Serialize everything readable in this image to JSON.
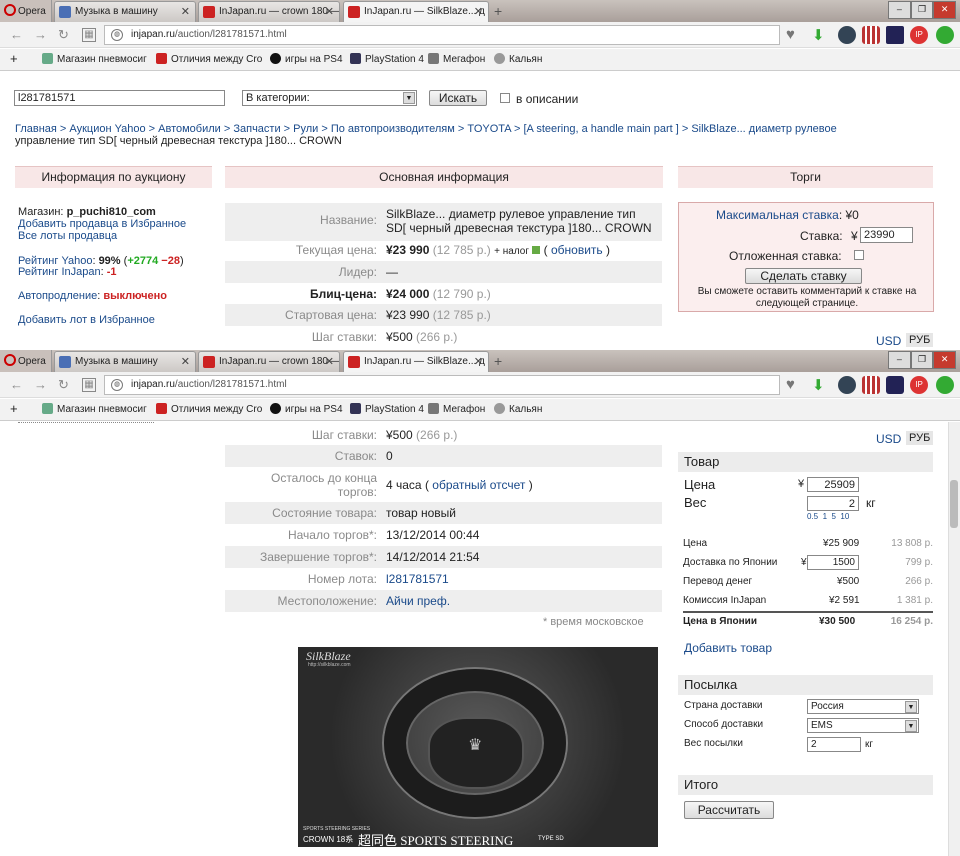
{
  "browser": {
    "opera_label": "Opera",
    "tabs": [
      {
        "label": "Музыка в машину"
      },
      {
        "label": "InJapan.ru — crown 180 —"
      },
      {
        "label": "InJapan.ru — SilkBlaze... д"
      }
    ],
    "url_host": "injapan.ru",
    "url_path": "/auction/l281781571.html",
    "bookmarks": [
      "Магазин пневмосиг",
      "Отличия между Cro",
      "игры на PS4",
      "PlayStation 4",
      "Мегафон",
      "Кальян"
    ]
  },
  "search": {
    "query": "l281781571",
    "category": "В категории:",
    "button": "Искать",
    "in_description": "в описании"
  },
  "breadcrumb": {
    "line1": "Главная > Аукцион Yahoo > Автомобили > Запчасти > Рули > По автопроизводителям > TOYOTA > [A steering, a handle main part ] > SilkBlaze... диаметр рулевое",
    "line2": "управление тип SD[ черный древесная текстура ]180... CROWN"
  },
  "auction_info": {
    "header": "Информация по аукциону",
    "shop_label": "Магазин:",
    "shop_name": "p_puchi810_com",
    "add_seller": "Добавить продавца в Избранное",
    "all_lots": "Все лоты продавца",
    "yahoo_rating_label": "Рейтинг Yahoo",
    "yahoo_rating": "99%",
    "rating_pos": "+2774",
    "rating_neg": "−28",
    "injapan_rating_label": "Рейтинг InJapan",
    "injapan_rating": "-1",
    "autoext_label": "Автопродление",
    "autoext_value": "выключено",
    "add_lot": "Добавить лот в Избранное"
  },
  "main_info": {
    "header": "Основная информация",
    "name_label": "Название:",
    "name_line1": "SilkBlaze... диаметр рулевое управление тип",
    "name_line2": "SD[ черный древесная текстура ]180... CROWN",
    "current_price_label": "Текущая цена:",
    "current_price": "¥23 990",
    "current_price_rub": "(12 785 р.)",
    "tax": "+ налог",
    "refresh": "обновить",
    "leader_label": "Лидер:",
    "leader": "—",
    "blitz_label": "Блиц-цена:",
    "blitz": "¥24 000",
    "blitz_rub": "(12 790 р.)",
    "start_label": "Стартовая цена:",
    "start": "¥23 990",
    "start_rub": "(12 785 р.)",
    "step_label": "Шаг ставки:",
    "step": "¥500",
    "step_rub": "(266 р.)",
    "bids_label": "Ставок:",
    "bids": "0",
    "remaining_label_1": "Осталось до конца",
    "remaining_label_2": "торгов:",
    "remaining": "4 часа",
    "countdown": "обратный отсчет",
    "condition_label": "Состояние товара:",
    "condition": "товар новый",
    "start_date_label": "Начало торгов*:",
    "start_date": "13/12/2014 00:44",
    "end_date_label": "Завершение торгов*:",
    "end_date": "14/12/2014 21:54",
    "lot_label": "Номер лота:",
    "lot": "l281781571",
    "location_label": "Местоположение:",
    "location": "Айчи преф.",
    "footnote": "* время московское"
  },
  "bidding": {
    "header": "Торги",
    "max_bid_label": "Максимальная ставка",
    "max_bid": "¥0",
    "bid_label": "Ставка:",
    "bid_value": "23990",
    "deferred_label": "Отложенная ставка:",
    "make_bid": "Сделать ставку",
    "note": "Вы сможете оставить комментарий к ставке на следующей странице."
  },
  "currency": {
    "usd": "USD",
    "rub": "РУБ"
  },
  "product": {
    "header": "Товар",
    "price_label": "Цена",
    "price_value": "25909",
    "weight_label": "Вес",
    "weight_value": "2",
    "weight_unit": "кг",
    "weight_presets": [
      "0.5",
      "1",
      "5",
      "10"
    ],
    "rows": [
      {
        "label": "Цена",
        "yen": "¥25 909",
        "rub": "13 808 р."
      },
      {
        "label": "Доставка по Японии",
        "yen": "1500",
        "rub": "799 р."
      },
      {
        "label": "Перевод денег",
        "yen": "¥500",
        "rub": "266 р."
      },
      {
        "label": "Комиссия InJapan",
        "yen": "¥2 591",
        "rub": "1 381 р."
      }
    ],
    "total_label": "Цена в Японии",
    "total_yen": "¥30 500",
    "total_rub": "16 254 р.",
    "add_product": "Добавить товар"
  },
  "parcel": {
    "header": "Посылка",
    "country_label": "Страна доставки",
    "country": "Россия",
    "method_label": "Способ доставки",
    "method": "EMS",
    "weight_label": "Вес посылки",
    "weight": "2",
    "unit": "кг"
  },
  "total": {
    "header": "Итого",
    "calc": "Рассчитать"
  },
  "image": {
    "brand": "SilkBlaze",
    "url": "http://silkblaze.com",
    "series": "SPORTS STEERING SERIES",
    "model": "CROWN 18系",
    "title": "超同色 SPORTS STEERING",
    "type": "TYPE SD"
  }
}
